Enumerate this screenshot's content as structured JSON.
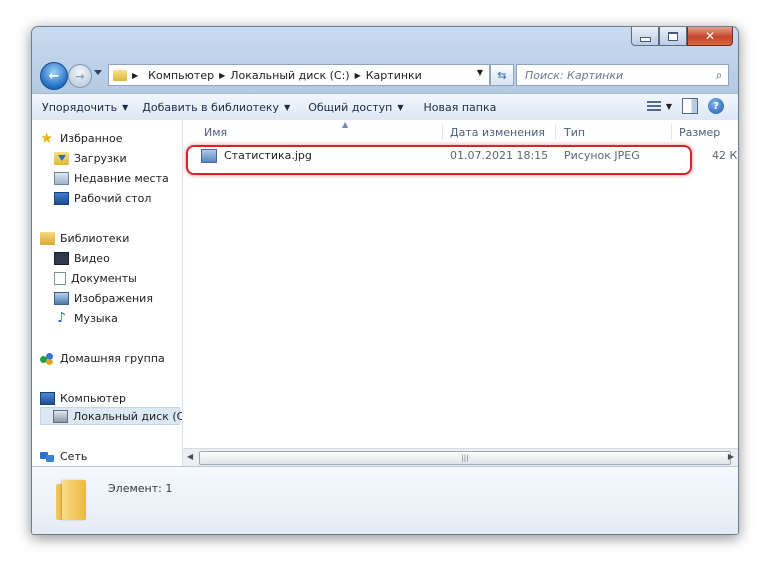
{
  "address": {
    "crumbs": [
      "Компьютер",
      "Локальный диск (C:)",
      "Картинки"
    ]
  },
  "search": {
    "placeholder": "Поиск: Картинки"
  },
  "toolbar": {
    "organize": "Упорядочить",
    "add_to_library": "Добавить в библиотеку",
    "share": "Общий доступ",
    "new_folder": "Новая папка"
  },
  "nav": {
    "favorites": "Избранное",
    "downloads": "Загрузки",
    "recent": "Недавние места",
    "desktop": "Рабочий стол",
    "libraries": "Библиотеки",
    "video": "Видео",
    "documents": "Документы",
    "images": "Изображения",
    "music": "Музыка",
    "homegroup": "Домашняя группа",
    "computer": "Компьютер",
    "local_disk": "Локальный диск (C",
    "network": "Сеть"
  },
  "columns": {
    "name": "Имя",
    "date": "Дата изменения",
    "type": "Тип",
    "size": "Размер"
  },
  "files": [
    {
      "name": "Статистика.jpg",
      "date": "01.07.2021 18:15",
      "type": "Рисунок JPEG",
      "size": "42 К"
    }
  ],
  "details": {
    "count": "Элемент: 1"
  },
  "icons": {
    "back": "back-arrow-icon",
    "forward": "forward-arrow-icon",
    "refresh": "refresh-icon",
    "search": "magnifier-icon",
    "help": "help-icon"
  },
  "colors": {
    "highlight": "#d6242c",
    "window_frame": "#b5cbe4"
  }
}
